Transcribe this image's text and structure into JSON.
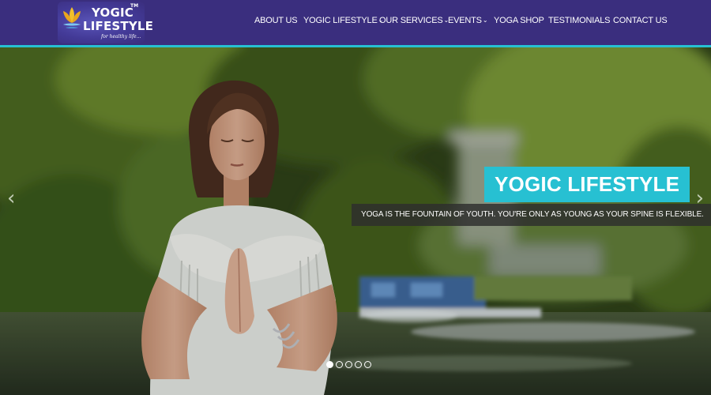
{
  "brand": {
    "line1": "YOGIC",
    "line2": "LIFESTYLE",
    "tm": "TM",
    "tagline": "for healthy life...",
    "colors": {
      "header_bg": "#3a2e7e",
      "accent": "#27c0d2"
    },
    "logo_icon": "lotus-icon"
  },
  "nav": {
    "items": [
      {
        "label": "ABOUT US",
        "dropdown": false
      },
      {
        "label": "YOGIC LIFESTYLE",
        "dropdown": true
      },
      {
        "label": "OUR SERVICES",
        "dropdown": true
      },
      {
        "label": "EVENTS",
        "dropdown": true
      },
      {
        "label": "YOGA SHOP",
        "dropdown": false
      },
      {
        "label": "TESTIMONIALS",
        "dropdown": false
      },
      {
        "label": "CONTACT US",
        "dropdown": false
      }
    ],
    "dropdown_icon": "chevron-down-icon"
  },
  "hero": {
    "title": "YOGIC LIFESTYLE",
    "subtitle": "YOGA IS THE FOUNTAIN OF YOUTH. YOU'RE ONLY AS YOUNG AS YOUR SPINE IS FLEXIBLE.",
    "prev_icon": "chevron-left-icon",
    "next_icon": "chevron-right-icon",
    "prev_glyph": "‹",
    "next_glyph": "›",
    "slides_total": 5,
    "active_slide": 1
  }
}
